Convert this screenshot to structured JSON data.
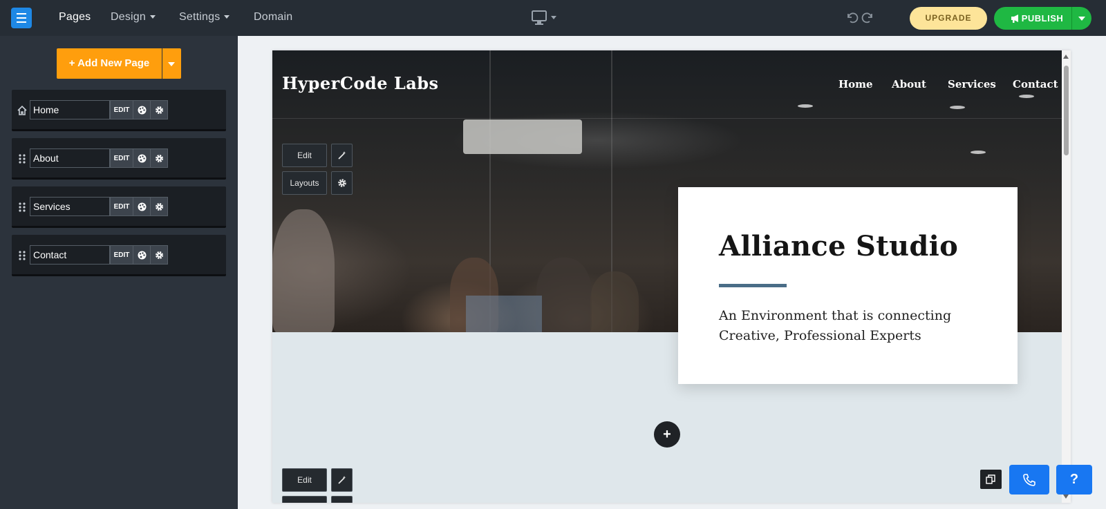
{
  "topbar": {
    "nav": [
      {
        "label": "Pages"
      },
      {
        "label": "Design"
      },
      {
        "label": "Settings"
      },
      {
        "label": "Domain"
      }
    ],
    "upgrade_label": "UPGRADE",
    "publish_label": "PUBLISH"
  },
  "sidebar": {
    "add_page_label": "+ Add New Page",
    "pages": [
      {
        "name": "Home",
        "edit_label": "EDIT"
      },
      {
        "name": "About",
        "edit_label": "EDIT"
      },
      {
        "name": "Services",
        "edit_label": "EDIT"
      },
      {
        "name": "Contact",
        "edit_label": "EDIT"
      }
    ]
  },
  "site": {
    "brand": "HyperCode Labs",
    "nav": [
      "Home",
      "About",
      "Services",
      "Contact"
    ],
    "hero_title": "Alliance Studio",
    "hero_text": "An Environment that is connecting Creative, Professional Experts"
  },
  "editor_tools": {
    "edit_label": "Edit",
    "layouts_label": "Layouts",
    "add_section_label": "+",
    "help_label": "?"
  },
  "colors": {
    "topbar": "#262d35",
    "sidebar": "#2c333c",
    "add_page": "#ff9e0d",
    "upgrade": "#fde499",
    "publish": "#1fb843",
    "help": "#1877f2",
    "accent_rule": "#4a6d87"
  }
}
